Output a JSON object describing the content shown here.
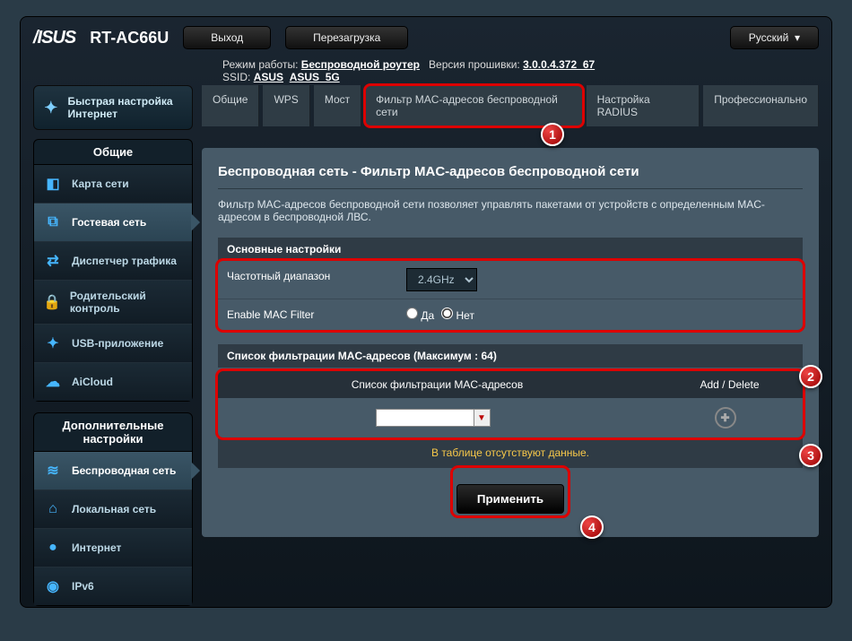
{
  "header": {
    "model": "RT-AC66U",
    "logout": "Выход",
    "reboot": "Перезагрузка",
    "language": "Русский"
  },
  "info": {
    "mode_label": "Режим работы:",
    "mode_value": "Беспроводной роутер",
    "fw_label": "Версия прошивки:",
    "fw_value": "3.0.0.4.372_67",
    "ssid_label": "SSID:",
    "ssid_1": "ASUS",
    "ssid_2": "ASUS_5G"
  },
  "qis": {
    "label": "Быстрая настройка Интернет"
  },
  "menu": {
    "general_head": "Общие",
    "items_general": [
      {
        "label": "Карта сети",
        "icon": "◧"
      },
      {
        "label": "Гостевая сеть",
        "icon": "⧉"
      },
      {
        "label": "Диспетчер трафика",
        "icon": "⇄"
      },
      {
        "label": "Родительский контроль",
        "icon": "🔒"
      },
      {
        "label": "USB-приложение",
        "icon": "✦"
      },
      {
        "label": "AiCloud",
        "icon": "☁"
      }
    ],
    "advanced_head": "Дополнительные настройки",
    "items_adv": [
      {
        "label": "Беспроводная сеть",
        "icon": "≋"
      },
      {
        "label": "Локальная сеть",
        "icon": "⌂"
      },
      {
        "label": "Интернет",
        "icon": "●"
      },
      {
        "label": "IPv6",
        "icon": "◉"
      }
    ]
  },
  "tabs": [
    "Общие",
    "WPS",
    "Мост",
    "Фильтр MAC-адресов беспроводной сети",
    "Настройка RADIUS",
    "Профессионально"
  ],
  "page": {
    "title": "Беспроводная сеть - Фильтр MAC-адресов беспроводной сети",
    "desc": "Фильтр MAC-адресов беспроводной сети позволяет управлять пакетами от устройств с определенным MAC-адресом в беспроводной ЛВС.",
    "basic_head": "Основные настройки",
    "freq_label": "Частотный диапазон",
    "freq_value": "2.4GHz",
    "enable_label": "Enable MAC Filter",
    "yes": "Да",
    "no": "Нет",
    "list_head": "Список фильтрации MAC-адресов (Максимум : 64)",
    "col_list": "Список фильтрации MAC-адресов",
    "col_add": "Add / Delete",
    "empty": "В таблице отсутствуют данные.",
    "apply": "Применить"
  }
}
